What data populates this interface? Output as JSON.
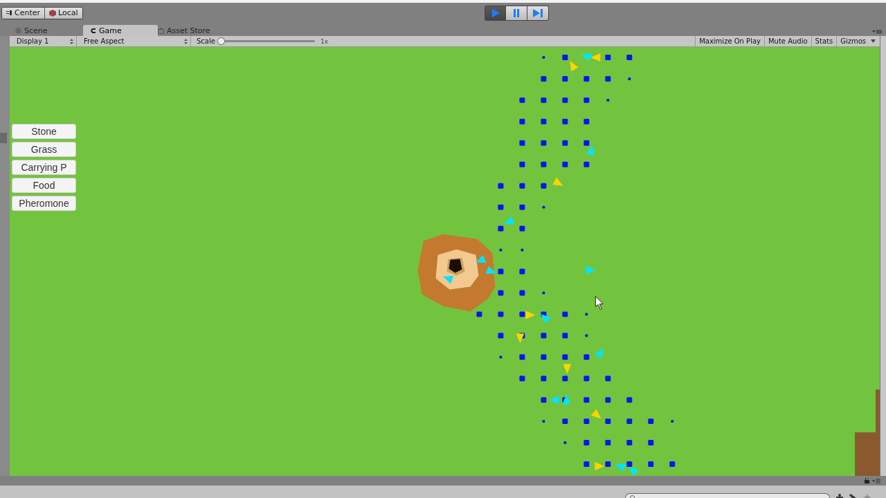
{
  "toolbar": {
    "pivot_buttons": [
      {
        "label": "Center",
        "kind": "pivot"
      },
      {
        "label": "Local",
        "kind": "space"
      }
    ],
    "play_controls": [
      {
        "kind": "play",
        "selected": true
      },
      {
        "kind": "pause",
        "selected": false
      },
      {
        "kind": "step",
        "selected": false
      }
    ]
  },
  "tabs": [
    {
      "label": "Scene",
      "kind": "scene",
      "selected": false
    },
    {
      "label": "Game",
      "kind": "game",
      "selected": true
    },
    {
      "label": "Asset Store",
      "kind": "store",
      "selected": false
    }
  ],
  "game_toolbar": {
    "display": "Display 1",
    "aspect": "Free Aspect",
    "scale": {
      "label": "Scale",
      "level": 0,
      "reading": "1x"
    },
    "buttons": [
      "Maximize On Play",
      "Mute Audio",
      "Stats",
      "Gizmos"
    ]
  },
  "game_buttons": [
    "Stone",
    "Grass",
    "Carrying P",
    "Food",
    "Pheromone"
  ]
}
